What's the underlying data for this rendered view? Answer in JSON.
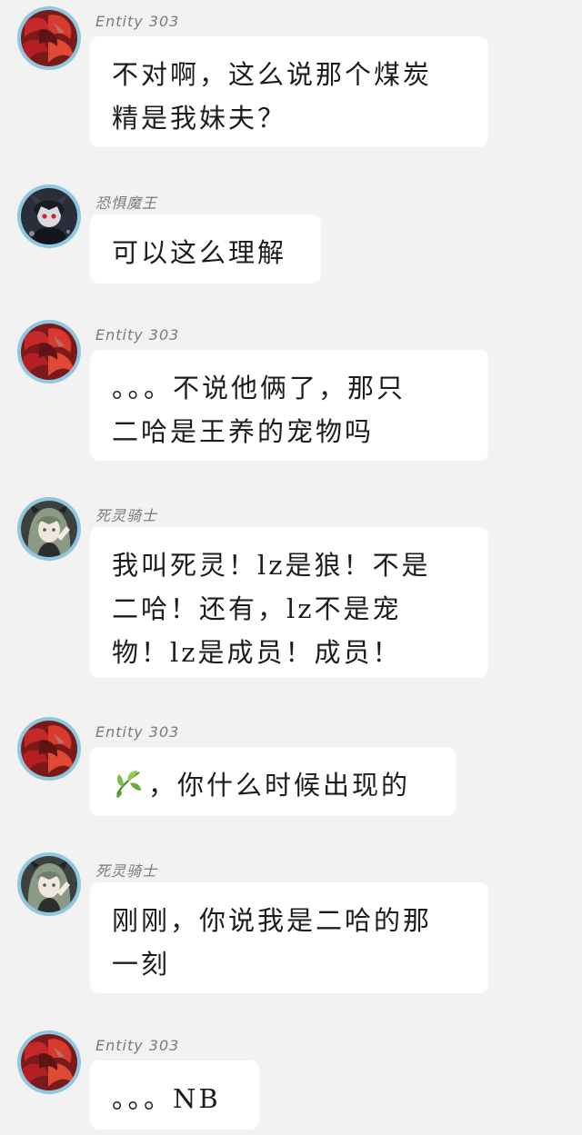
{
  "messages": [
    {
      "sender": "Entity 303",
      "avatar": "red-petals-avatar",
      "text": "不对啊，这么说那个煤炭\n精是我妹夫？"
    },
    {
      "sender": "恐惧魔王",
      "avatar": "dark-demon-avatar",
      "text": "可以这么理解"
    },
    {
      "sender": "Entity 303",
      "avatar": "red-petals-avatar",
      "text": "。。。不说他俩了，那只\n二哈是王养的宠物吗"
    },
    {
      "sender": "死灵骑士",
      "avatar": "green-haired-girl-avatar",
      "text": "我叫死灵！lz是狼！不是\n二哈！还有，lz不是宠\n物！lz是成员！成员！"
    },
    {
      "sender": "Entity 303",
      "avatar": "red-petals-avatar",
      "emoji": "herb-leaf-icon",
      "text": "，你什么时候出现的"
    },
    {
      "sender": "死灵骑士",
      "avatar": "green-haired-girl-avatar",
      "text": "刚刚，你说我是二哈的那\n一刻"
    },
    {
      "sender": "Entity 303",
      "avatar": "red-petals-avatar",
      "text": "。。。NB"
    }
  ],
  "colors": {
    "background": "#f2f2f2",
    "bubble": "#ffffff",
    "avatar_ring": "#8fc7e0",
    "sender_text": "#7a7a7a",
    "message_text": "#1c1c1c"
  }
}
